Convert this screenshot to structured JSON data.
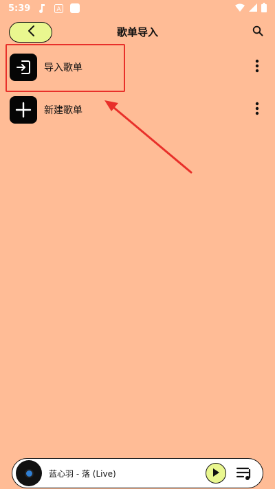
{
  "status_bar": {
    "time": "5:39"
  },
  "header": {
    "title": "歌单导入"
  },
  "list": [
    {
      "label": "导入歌单",
      "icon": "import-icon"
    },
    {
      "label": "新建歌单",
      "icon": "plus-icon"
    }
  ],
  "player": {
    "song": "蓝心羽 - 落 (Live)"
  },
  "colors": {
    "background": "#FFBC96",
    "accent": "#E9F78F",
    "annotation": "#E8302A"
  }
}
